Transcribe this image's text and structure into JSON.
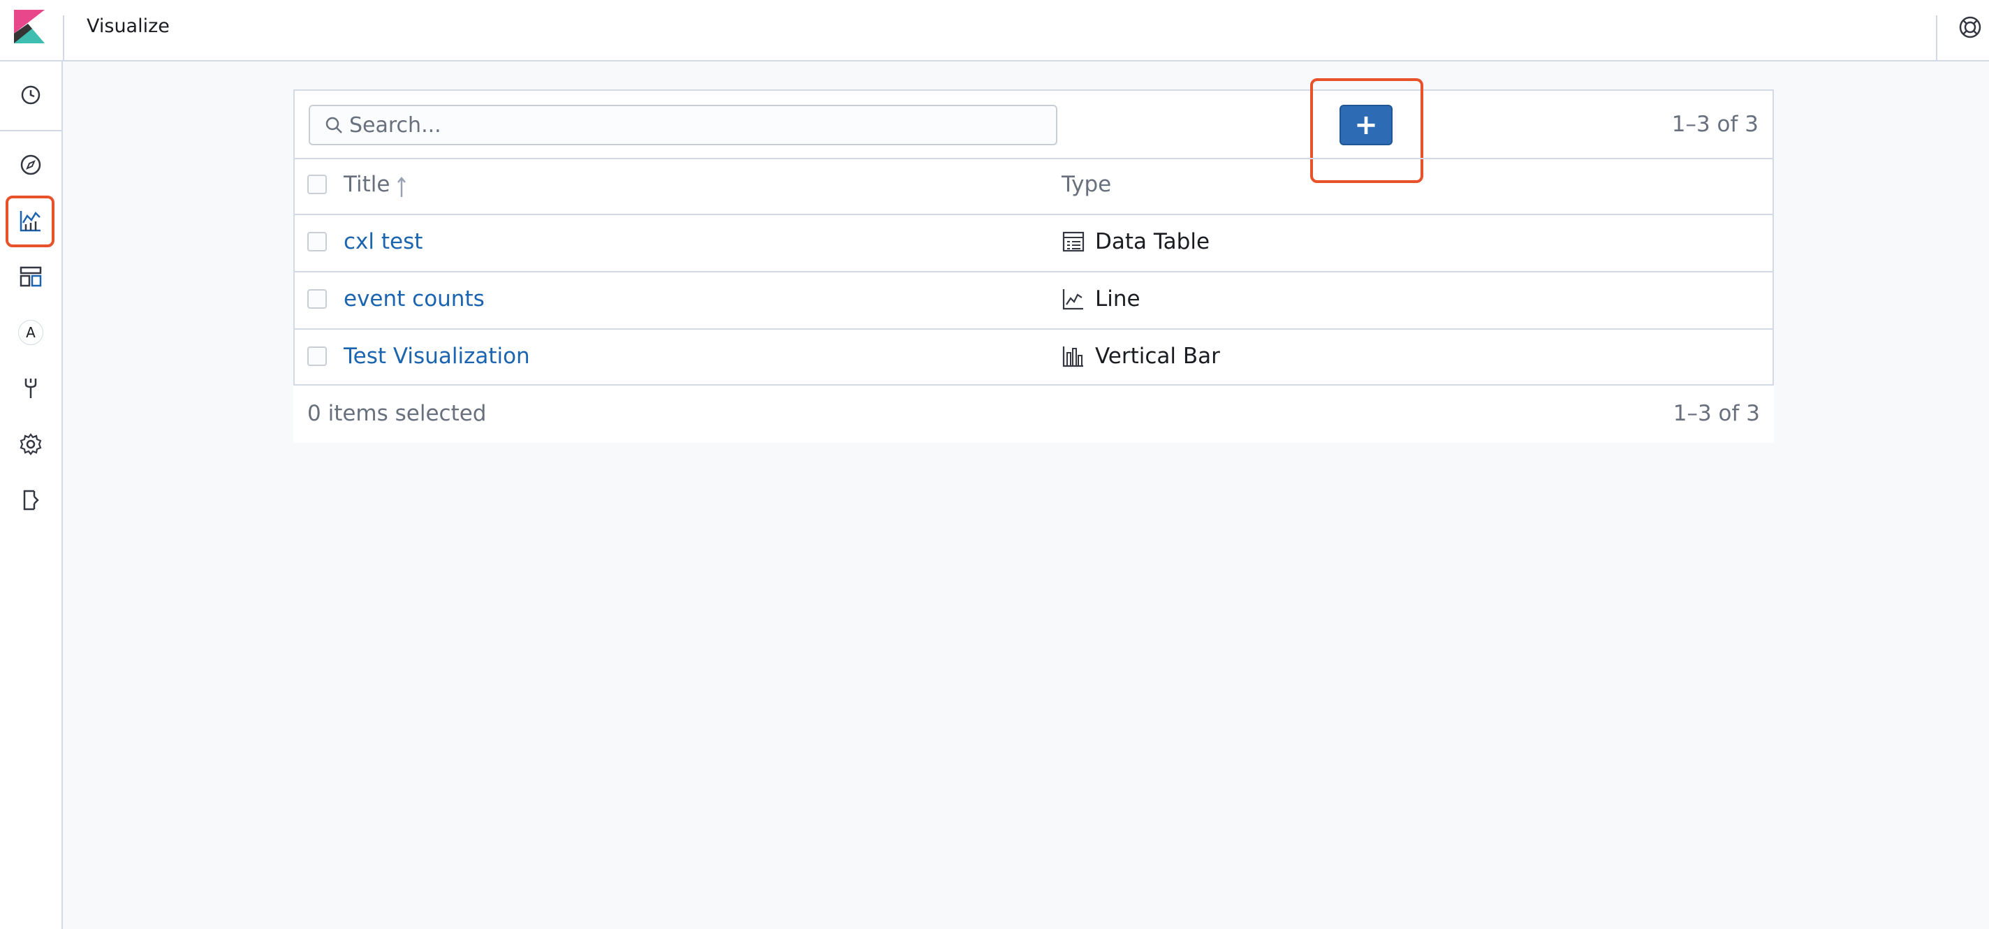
{
  "header": {
    "app_title": "Visualize",
    "logo_icon": "kibana-logo",
    "help_icon": "help-lifebuoy-icon"
  },
  "sidenav": {
    "items": [
      {
        "name": "recently-viewed",
        "icon": "clock-icon"
      },
      {
        "name": "discover",
        "icon": "compass-icon"
      },
      {
        "name": "visualize",
        "icon": "visualize-icon",
        "active": true
      },
      {
        "name": "dashboard",
        "icon": "dashboard-icon"
      },
      {
        "name": "account",
        "icon": "avatar-icon",
        "label": "A"
      },
      {
        "name": "dev-tools",
        "icon": "wrench-icon"
      },
      {
        "name": "management",
        "icon": "gear-icon"
      },
      {
        "name": "logout",
        "icon": "logout-icon"
      }
    ]
  },
  "toolbar": {
    "search_placeholder": "Search...",
    "add_label": "+",
    "pagination": "1–3 of 3"
  },
  "table": {
    "columns": [
      "Title",
      "Type"
    ],
    "sort_indicator": "↑",
    "rows": [
      {
        "title": "cxl test",
        "type": "Data Table",
        "type_icon": "data-table-icon"
      },
      {
        "title": "event counts",
        "type": "Line",
        "type_icon": "line-chart-icon"
      },
      {
        "title": "Test Visualization",
        "type": "Vertical Bar",
        "type_icon": "vertical-bar-icon"
      }
    ]
  },
  "footer": {
    "selected_text": "0 items selected",
    "pagination": "1–3 of 3"
  },
  "colors": {
    "accent": "#2d6bb5",
    "link": "#1b64b0",
    "highlight": "#e7522a"
  }
}
